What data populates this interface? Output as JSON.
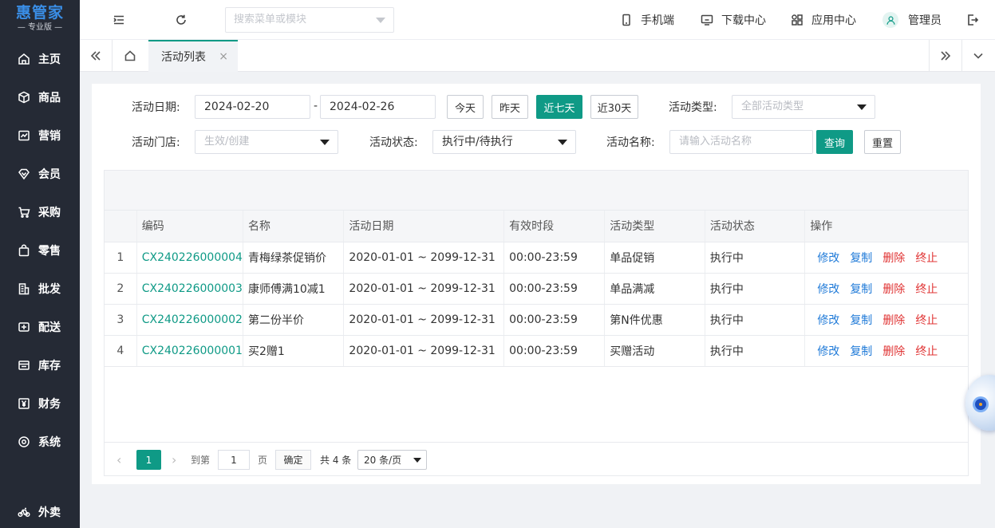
{
  "logo": {
    "main": "惠管家",
    "sub": "— 专业版 —"
  },
  "sidebar": {
    "items": [
      {
        "label": "主页",
        "icon": "home-icon"
      },
      {
        "label": "商品",
        "icon": "box-icon"
      },
      {
        "label": "营销",
        "icon": "chart-icon"
      },
      {
        "label": "会员",
        "icon": "diamond-icon"
      },
      {
        "label": "采购",
        "icon": "cart-icon"
      },
      {
        "label": "零售",
        "icon": "bag-icon"
      },
      {
        "label": "批发",
        "icon": "building-icon"
      },
      {
        "label": "配送",
        "icon": "truck-icon"
      },
      {
        "label": "库存",
        "icon": "inventory-icon"
      },
      {
        "label": "财务",
        "icon": "yen-icon"
      },
      {
        "label": "系统",
        "icon": "settings-icon"
      }
    ],
    "bottom_item": {
      "label": "外卖",
      "icon": "bike-icon"
    }
  },
  "header": {
    "search_placeholder": "搜索菜单或模块",
    "links": {
      "mobile": "手机端",
      "download": "下载中心",
      "apps": "应用中心",
      "user": "管理员"
    }
  },
  "tabs": {
    "active_label": "活动列表",
    "close": "×"
  },
  "filters": {
    "date_label": "活动日期:",
    "date_start": "2024-02-20",
    "date_sep": "-",
    "date_end": "2024-02-26",
    "quick": {
      "today": "今天",
      "yesterday": "昨天",
      "week": "近七天",
      "month": "近30天"
    },
    "type_label": "活动类型:",
    "type_value": "全部活动类型",
    "store_label": "活动门店:",
    "store_value": "生效/创建",
    "status_label": "活动状态:",
    "status_value": "执行中/待执行",
    "name_label": "活动名称:",
    "name_placeholder": "请输入活动名称",
    "query_btn": "查询",
    "reset_btn": "重置"
  },
  "table": {
    "headers": [
      "编码",
      "名称",
      "活动日期",
      "有效时段",
      "活动类型",
      "活动状态",
      "操作"
    ],
    "rows": [
      {
        "idx": "1",
        "code": "CX240226000004",
        "name": "青梅绿茶促销价",
        "date": "2020-01-01 ~ 2099-12-31",
        "period": "00:00-23:59",
        "type": "单品促销",
        "status": "执行中"
      },
      {
        "idx": "2",
        "code": "CX240226000003",
        "name": "康师傅满10减1",
        "date": "2020-01-01 ~ 2099-12-31",
        "period": "00:00-23:59",
        "type": "单品满减",
        "status": "执行中"
      },
      {
        "idx": "3",
        "code": "CX240226000002",
        "name": "第二份半价",
        "date": "2020-01-01 ~ 2099-12-31",
        "period": "00:00-23:59",
        "type": "第N件优惠",
        "status": "执行中"
      },
      {
        "idx": "4",
        "code": "CX240226000001",
        "name": "买2赠1",
        "date": "2020-01-01 ~ 2099-12-31",
        "period": "00:00-23:59",
        "type": "买赠活动",
        "status": "执行中"
      }
    ],
    "ops": {
      "edit": "修改",
      "copy": "复制",
      "delete": "删除",
      "stop": "终止"
    }
  },
  "pager": {
    "prev": "‹",
    "current": "1",
    "next": "›",
    "goto_label": "到第",
    "goto_value": "1",
    "page_unit": "页",
    "confirm": "确定",
    "total": "共 4 条",
    "page_size": "20 条/页"
  },
  "colors": {
    "primary": "#0f9a86",
    "sidebar_bg": "#252a35",
    "link_blue": "#1f7ad8",
    "danger": "#e03434"
  }
}
